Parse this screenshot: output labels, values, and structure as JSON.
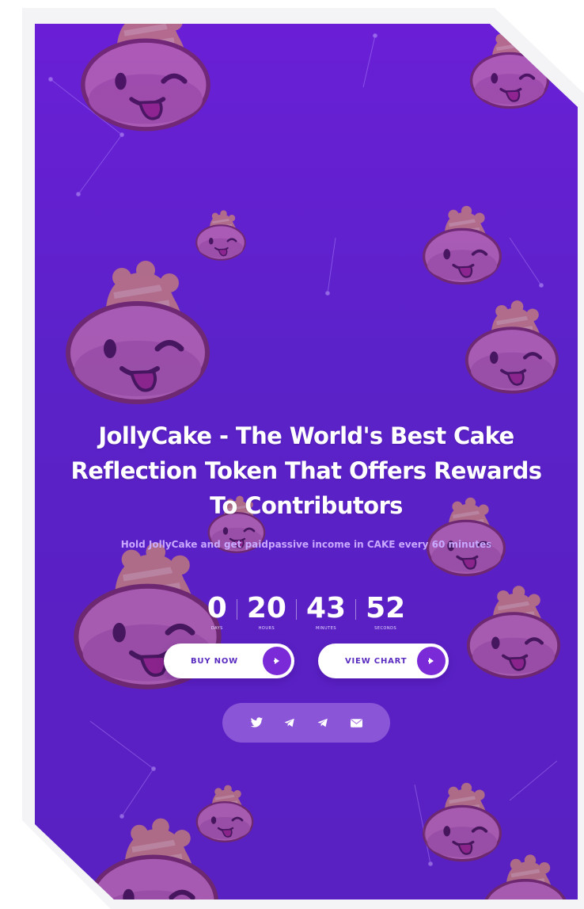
{
  "hero": {
    "title_line1": "JollyCake - The World's Best Cake",
    "title_line2": "Reflection Token That Offers Rewards",
    "title_line3": "To Contributors",
    "subtitle": "Hold JollyCake and get paidpassive income in CAKE every 60 minutes"
  },
  "countdown": {
    "days": "0",
    "days_label": "Days",
    "hours": "20",
    "hours_label": "Hours",
    "minutes": "43",
    "minutes_label": "Minutes",
    "seconds": "52",
    "seconds_label": "Seconds"
  },
  "actions": {
    "buy_label": "BUY NOW",
    "chart_label": "VIEW CHART"
  },
  "social": {
    "icons": [
      "twitter-icon",
      "telegram-icon",
      "telegram-icon",
      "email-icon"
    ]
  },
  "colors": {
    "background_top": "#6a1fd6",
    "background_bottom": "#5920c2",
    "accent": "#7b2ad8",
    "button_bg": "#ffffff",
    "subtitle": "#c9a9ff"
  }
}
